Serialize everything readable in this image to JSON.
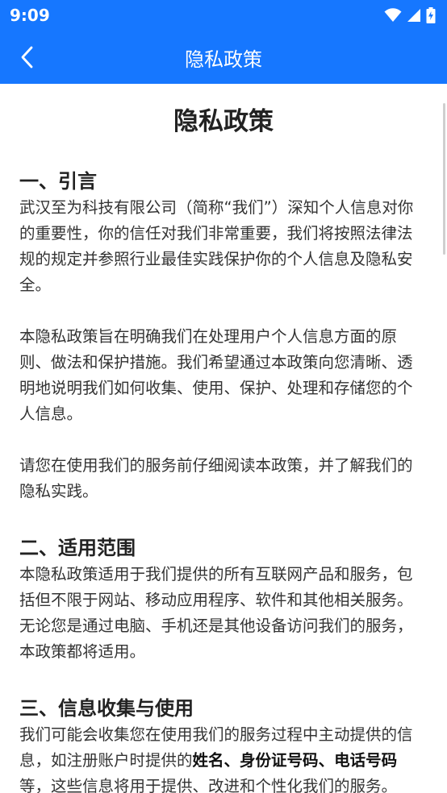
{
  "status": {
    "time": "9:09",
    "icons": [
      "wifi-icon",
      "signal-icon",
      "battery-icon"
    ]
  },
  "app_bar": {
    "title": "隐私政策",
    "back_icon": "chevron-left-icon"
  },
  "colors": {
    "primary": "#1677ff",
    "text": "#333333",
    "heading": "#222222"
  },
  "document": {
    "title": "隐私政策",
    "sections": [
      {
        "heading": "一、引言",
        "paragraphs": [
          "武汉至为科技有限公司（简称“我们”）深知个人信息对你的重要性，你的信任对我们非常重要，我们将按照法律法规的规定并参照行业最佳实践保护你的个人信息及隐私安全。",
          "本隐私政策旨在明确我们在处理用户个人信息方面的原则、做法和保护措施。我们希望通过本政策向您清晰、透明地说明我们如何收集、使用、保护、处理和存储您的个人信息。",
          "请您在使用我们的服务前仔细阅读本政策，并了解我们的隐私实践。"
        ]
      },
      {
        "heading": "二、适用范围",
        "paragraphs": [
          "本隐私政策适用于我们提供的所有互联网产品和服务，包括但不限于网站、移动应用程序、软件和其他相关服务。无论您是通过电脑、手机还是其他设备访问我们的服务，本政策都将适用。"
        ]
      },
      {
        "heading": "三、信息收集与使用",
        "intro": "我们可能会收集您在使用我们的服务过程中主动提供的信息，如注册账户时提供的",
        "bold_1": "姓名",
        "sep_1": "、",
        "bold_2": "身份证号码",
        "sep_2": "、",
        "bold_3": "电话号码",
        "rest": "等，这些信息将用于提供、改进和个性化我们的服务。"
      }
    ]
  }
}
